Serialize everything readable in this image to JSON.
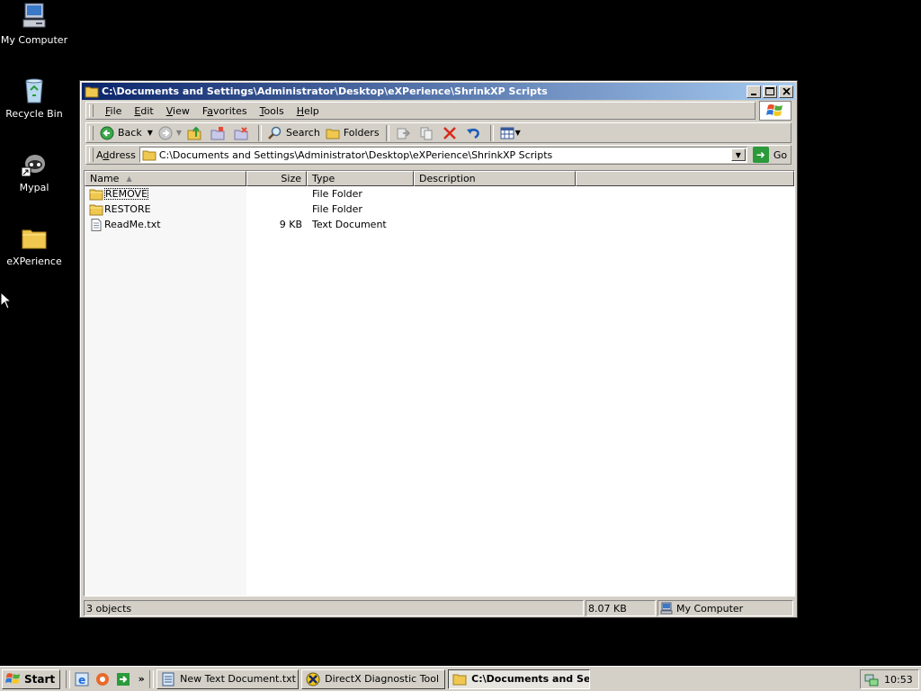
{
  "desktop": {
    "icons": [
      {
        "label": "My Computer"
      },
      {
        "label": "Recycle Bin"
      },
      {
        "label": "Mypal"
      },
      {
        "label": "eXPerience"
      }
    ]
  },
  "window": {
    "title": "C:\\Documents and Settings\\Administrator\\Desktop\\eXPerience\\ShrinkXP Scripts",
    "caption_buttons": {
      "minimize": "minimize-icon",
      "maximize": "maximize-icon",
      "close": "close-icon"
    },
    "menu": [
      {
        "key": "F",
        "rest": "ile"
      },
      {
        "key": "E",
        "rest": "dit"
      },
      {
        "key": "V",
        "rest": "iew"
      },
      {
        "key": "",
        "pre": "F",
        "key2": "a",
        "rest": "vorites"
      },
      {
        "key": "T",
        "rest": "ools"
      },
      {
        "key": "H",
        "rest": "elp"
      }
    ],
    "toolbar": {
      "back": "Back",
      "search": "Search",
      "folders": "Folders"
    },
    "address": {
      "label_key": "d",
      "label_pre": "A",
      "label_rest": "dress",
      "value": "C:\\Documents and Settings\\Administrator\\Desktop\\eXPerience\\ShrinkXP Scripts",
      "go": "Go"
    },
    "columns": [
      "Name",
      "Size",
      "Type",
      "Description"
    ],
    "files": [
      {
        "name": "REMOVE",
        "size": "",
        "type": "File Folder",
        "icon": "folder-icon"
      },
      {
        "name": "RESTORE",
        "size": "",
        "type": "File Folder",
        "icon": "folder-icon"
      },
      {
        "name": "ReadMe.txt",
        "size": "9 KB",
        "type": "Text Document",
        "icon": "text-file-icon"
      }
    ],
    "status": {
      "objects": "3 objects",
      "size": "8.07 KB",
      "zone": "My Computer"
    }
  },
  "taskbar": {
    "start": "Start",
    "chevron": "»",
    "tasks": [
      {
        "label": "New Text Document.txt ..."
      },
      {
        "label": "DirectX Diagnostic Tool"
      },
      {
        "label": "C:\\Documents and Se..."
      }
    ],
    "clock": "10:53"
  },
  "colors": {
    "desktop": "#000000",
    "titlebar_start": "#0a246a",
    "titlebar_end": "#a6caf0",
    "chrome": "#d4d0c8"
  }
}
